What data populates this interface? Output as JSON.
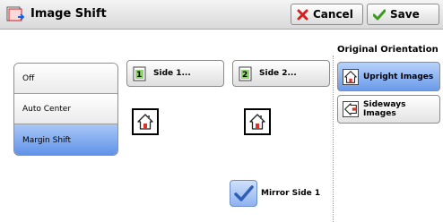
{
  "window": {
    "title": "Image Shift"
  },
  "toolbar": {
    "cancel_label": "Cancel",
    "save_label": "Save"
  },
  "shift_modes": [
    {
      "label": "Off",
      "selected": false
    },
    {
      "label": "Auto Center",
      "selected": false
    },
    {
      "label": "Margin Shift",
      "selected": true
    }
  ],
  "sides": {
    "side1_label": "Side 1...",
    "side2_label": "Side 2..."
  },
  "mirror": {
    "label": "Mirror Side 1",
    "checked": true
  },
  "orientation": {
    "heading": "Original Orientation",
    "upright_label": "Upright Images",
    "sideways_label": "Sideways Images",
    "selected": "upright"
  },
  "icons": {
    "title": "image-shift-icon",
    "cancel": "red-x-icon",
    "save": "green-check-icon",
    "side1": "side-1-page-icon",
    "side2": "side-2-page-icon",
    "preview": "house-icon",
    "upright": "upright-house-icon",
    "sideways": "sideways-house-icon",
    "mirror": "checkmark-icon"
  },
  "colors": {
    "selection_blue": "#5c8fe8",
    "cancel_red": "#d32020",
    "save_green": "#3a9a1e"
  }
}
